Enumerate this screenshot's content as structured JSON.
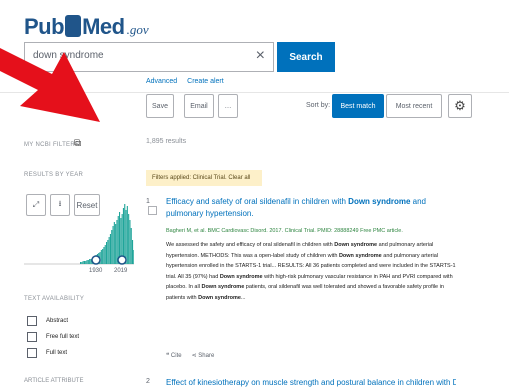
{
  "header": {
    "logo_pub": "Pub",
    "logo_med": "Med",
    "logo_gov": ".gov",
    "search_value": "down syndrome",
    "clear_label": "×",
    "search_button": "Search",
    "advanced_link": "Advanced",
    "create_alert_link": "Create alert"
  },
  "toolbar": {
    "save": "Save",
    "email": "Email",
    "more": "…",
    "sort_by": "Sort by:",
    "best_match": "Best match",
    "most_recent": "Most recent",
    "settings_icon": "gear-icon"
  },
  "sidebar": {
    "my_ncbi_filters": "MY NCBI FILTERS",
    "results_by_year": "RESULTS BY YEAR",
    "reset": "Reset",
    "year_start": "1930",
    "year_end": "2019",
    "text_availability": "TEXT AVAILABILITY",
    "filters": [
      "Abstract",
      "Free full text",
      "Full text"
    ],
    "article_attribute": "ARTICLE ATTRIBUTE"
  },
  "results": {
    "count": "1,895 results",
    "notice": "Filters applied: Clinical Trial. Clear all",
    "items": [
      {
        "number": "1",
        "title_start": "Efficacy and safety of oral sildenafil in children with ",
        "title_bold": "Down syndrome",
        "title_end": " and pulmonary hypertension.",
        "authors": "Bagheri M, et al. BMC Cardiovasc Disord. 2017. Clinical Trial. PMID: 28888249 Free PMC article.",
        "snippet_1": "We assessed the safety and efficacy of oral sildenafil in children with ",
        "snippet_bold_1": "Down syndrome",
        "snippet_2": " and pulmonary arterial hypertension. METHODS: This was a open-label study of children with ",
        "snippet_bold_2": "Down syndrome",
        "snippet_3": " and pulmonary arterial hypertension enrolled in the STARTS-1 trial... RESULTS: All 36 patients completed and were included in the STARTS-1 trial. All 35 (97%) had ",
        "snippet_bold_3": "Down syndrome",
        "snippet_4": " with high-risk pulmonary vascular resistance in PAH and PVRI compared with placebo. In all ",
        "snippet_bold_4": "Down syndrome",
        "snippet_5": " patients, oral sildenafil was well tolerated and showed a favorable safety profile in patients with ",
        "snippet_bold_5": "Down syndrome",
        "snippet_6": "...",
        "cite": "Cite",
        "share": "Share"
      },
      {
        "number": "2",
        "title": "Effect of kinesiotherapy on muscle strength and postural balance in children with Down syndrome."
      }
    ]
  },
  "colors": {
    "brand": "#20558a",
    "accent": "#0071bc",
    "arrow": "#e5101b",
    "histogram": "#20a59a"
  }
}
